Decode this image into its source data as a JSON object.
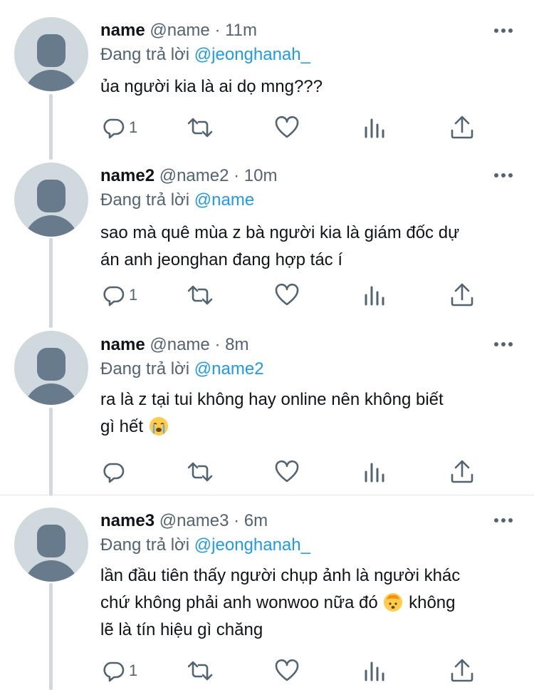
{
  "tweets": [
    {
      "display_name": "name",
      "handle_time": "@name · 11m",
      "replying_prefix": "Đang trả lời",
      "replying_to": "@jeonghanah_",
      "text": "ủa người kia là ai dọ mng???",
      "reply_count": "1"
    },
    {
      "display_name": "name2",
      "handle_time": "@name2 · 10m",
      "replying_prefix": "Đang trả lời",
      "replying_to": "@name",
      "text_line1": "sao mà quê mùa z bà người kia là giám đốc dự",
      "text_line2": "án anh jeonghan đang hợp tác í",
      "reply_count": "1"
    },
    {
      "display_name": "name",
      "handle_time": "@name · 8m",
      "replying_prefix": "Đang trả lời",
      "replying_to": "@name2",
      "text_line1": "ra là z tại tui không hay online nên không biết",
      "text_line2": "gì hết",
      "emoji": "crying-face",
      "reply_count": ""
    },
    {
      "display_name": "name3",
      "handle_time": "@name3 · 6m",
      "replying_prefix": "Đang trả lời",
      "replying_to": "@jeonghanah_",
      "text_line1": "lần đầu tiên thấy người chụp ảnh là người khác",
      "text_line2a": "chứ không phải anh wonwoo nữa đó",
      "text_line2b": "không",
      "text_line3": "lẽ là tín hiệu gì chăng",
      "emoji": "exploding-head",
      "reply_count": "1"
    }
  ],
  "icons": {
    "reply": "reply-icon",
    "retweet": "retweet-icon",
    "like": "heart-icon",
    "views": "analytics-icon",
    "share": "share-icon",
    "more": "more-icon"
  },
  "colors": {
    "text": "#0f1419",
    "secondary": "#536471",
    "mention": "#1d9bf0",
    "avatar_bg": "#cfd9de",
    "avatar_fg": "#687b8c",
    "thread_line": "#cfd9de"
  }
}
